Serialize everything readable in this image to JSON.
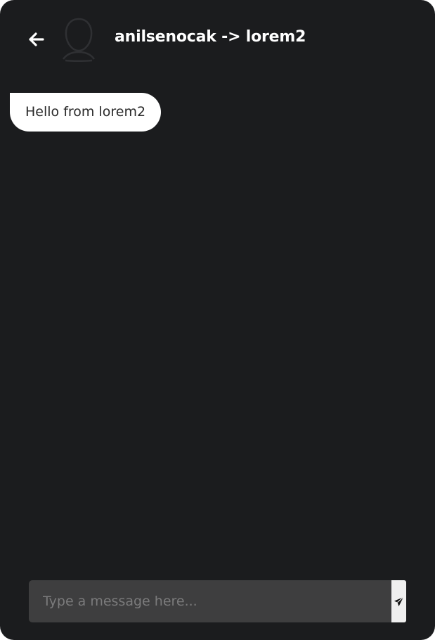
{
  "header": {
    "title": "anilsenocak -> lorem2",
    "back_icon": "arrow-left-icon",
    "avatar_icon": "user-silhouette-icon"
  },
  "messages": [
    {
      "text": "Hello from lorem2",
      "direction": "incoming"
    }
  ],
  "composer": {
    "placeholder": "Type a message here...",
    "value": "",
    "send_icon": "paper-plane-icon"
  },
  "colors": {
    "background": "#1b1c1e",
    "bubble": "#ffffff",
    "input_background": "#3e3e3f",
    "send_button": "#efefef"
  }
}
